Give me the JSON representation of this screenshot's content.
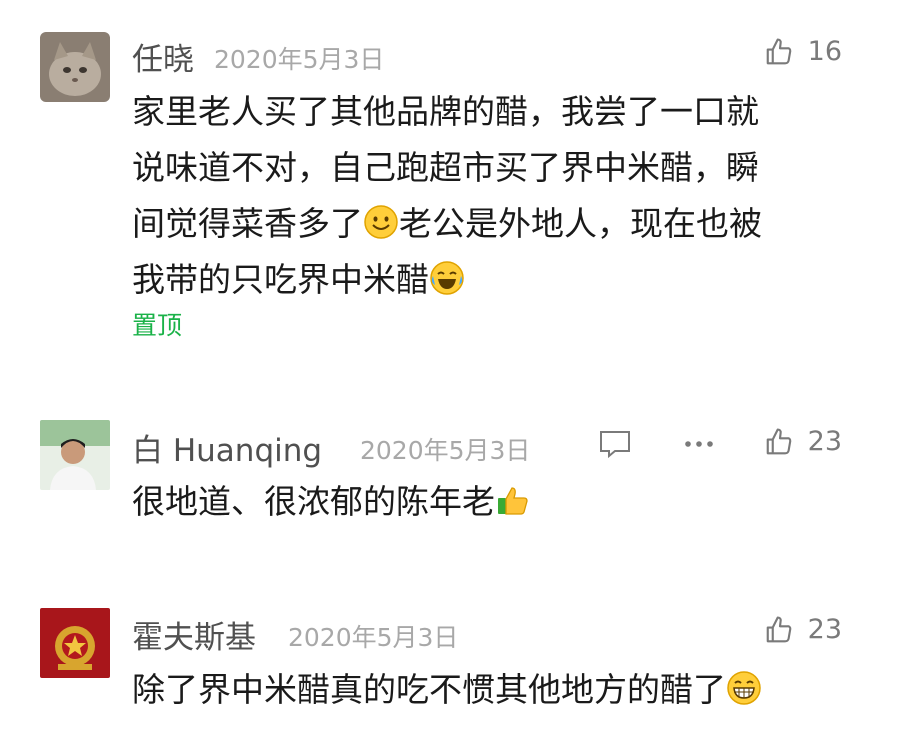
{
  "comments": [
    {
      "author": "任晓",
      "date": "2020年5月3日",
      "likes": "16",
      "text_lines": [
        "家里老人买了其他品牌的醋，我尝了一口就",
        "说味道不对，自己跑超市买了界中米醋，瞬",
        "间觉得菜香多了",
        "老公是外地人，现在也被",
        "我带的只吃界中米醋"
      ],
      "pin_label": "置顶"
    },
    {
      "author": "白 Huanqing",
      "date": "2020年5月3日",
      "likes": "23",
      "text": "很地道、很浓郁的陈年老"
    },
    {
      "author": "霍夫斯基",
      "date": "2020年5月3日",
      "likes": "23",
      "text": "除了界中米醋真的吃不惯其他地方的醋了"
    }
  ],
  "icons": {
    "like": "thumbs-up-icon",
    "reply": "comment-bubble-icon",
    "more": "more-dots-icon",
    "emoji_smile": "smile-emoji-icon",
    "emoji_laugh_cry": "laugh-cry-emoji-icon",
    "emoji_thumbs": "thumbs-up-emoji-icon",
    "emoji_grin": "grin-emoji-icon"
  },
  "colors": {
    "pin": "#1ab248",
    "date": "#a8a8a8",
    "name": "#505050"
  }
}
